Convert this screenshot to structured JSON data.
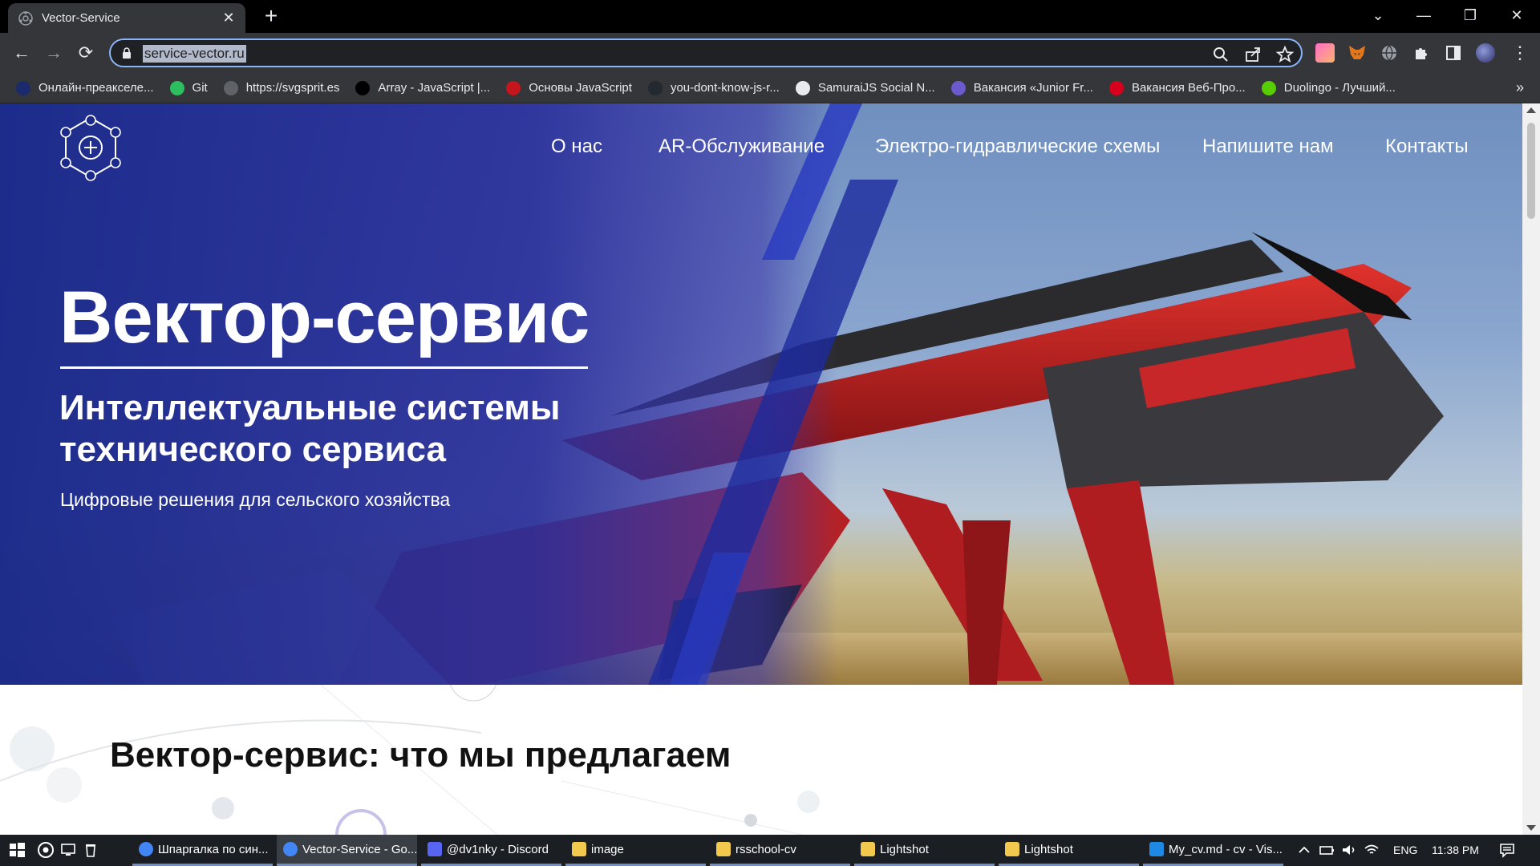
{
  "browser": {
    "tab": {
      "title": "Vector-Service",
      "close": "✕"
    },
    "new_tab": "+",
    "window_controls": {
      "dropdown": "⌄",
      "minimize": "—",
      "restore": "❐",
      "close": "✕"
    },
    "nav": {
      "back": "←",
      "forward": "→",
      "reload": "⟳"
    },
    "url": "service-vector.ru",
    "omnibox_icons": [
      "search-icon",
      "share-icon",
      "star-icon"
    ],
    "bookmarks": [
      {
        "label": "Онлайн-преакселе...",
        "icon": "ai-icon",
        "color": "#1a2a6c"
      },
      {
        "label": "Git",
        "icon": "evernote-icon",
        "color": "#2dbe60"
      },
      {
        "label": "https://svgsprit.es",
        "icon": "globe-icon",
        "color": "#5f6368"
      },
      {
        "label": "Array - JavaScript |...",
        "icon": "mdn-icon",
        "color": "#000000"
      },
      {
        "label": "Основы JavaScript",
        "icon": "person-icon",
        "color": "#c4161c"
      },
      {
        "label": "you-dont-know-js-r...",
        "icon": "github-icon",
        "color": "#24292f"
      },
      {
        "label": "SamuraiJS Social N...",
        "icon": "doc-icon",
        "color": "#e8eaed"
      },
      {
        "label": "Вакансия «Junior Fr...",
        "icon": "star-burst-icon",
        "color": "#6a5acd"
      },
      {
        "label": "Вакансия Веб-Про...",
        "icon": "hh-icon",
        "color": "#d6001c"
      },
      {
        "label": "Duolingo - Лучший...",
        "icon": "duolingo-icon",
        "color": "#58cc02"
      }
    ],
    "bookmarks_more": "»"
  },
  "page": {
    "nav": [
      "О нас",
      "AR-Обслуживание",
      "Электро-гидравлические схемы",
      "Напишите нам",
      "Контакты"
    ],
    "hero_title": "Вектор-сервис",
    "hero_subtitle": "Интеллектуальные системы технического сервиса",
    "hero_description": "Цифровые решения для сельского хозяйства",
    "section_title": "Вектор-сервис: что мы предлагаем"
  },
  "taskbar": {
    "apps": [
      {
        "label": "Шпаргалка по син...",
        "icon": "chrome-icon",
        "active": false
      },
      {
        "label": "Vector-Service - Go...",
        "icon": "chrome-icon",
        "active": true
      },
      {
        "label": "@dv1nky - Discord",
        "icon": "discord-icon",
        "active": false
      },
      {
        "label": "image",
        "icon": "folder-icon",
        "active": false
      },
      {
        "label": "rsschool-cv",
        "icon": "folder-icon",
        "active": false
      },
      {
        "label": "Lightshot",
        "icon": "folder-icon",
        "active": false
      },
      {
        "label": "Lightshot",
        "icon": "folder-icon",
        "active": false
      },
      {
        "label": "My_cv.md - cv - Vis...",
        "icon": "vscode-icon",
        "active": false
      }
    ],
    "language": "ENG",
    "time": "11:38 PM"
  }
}
